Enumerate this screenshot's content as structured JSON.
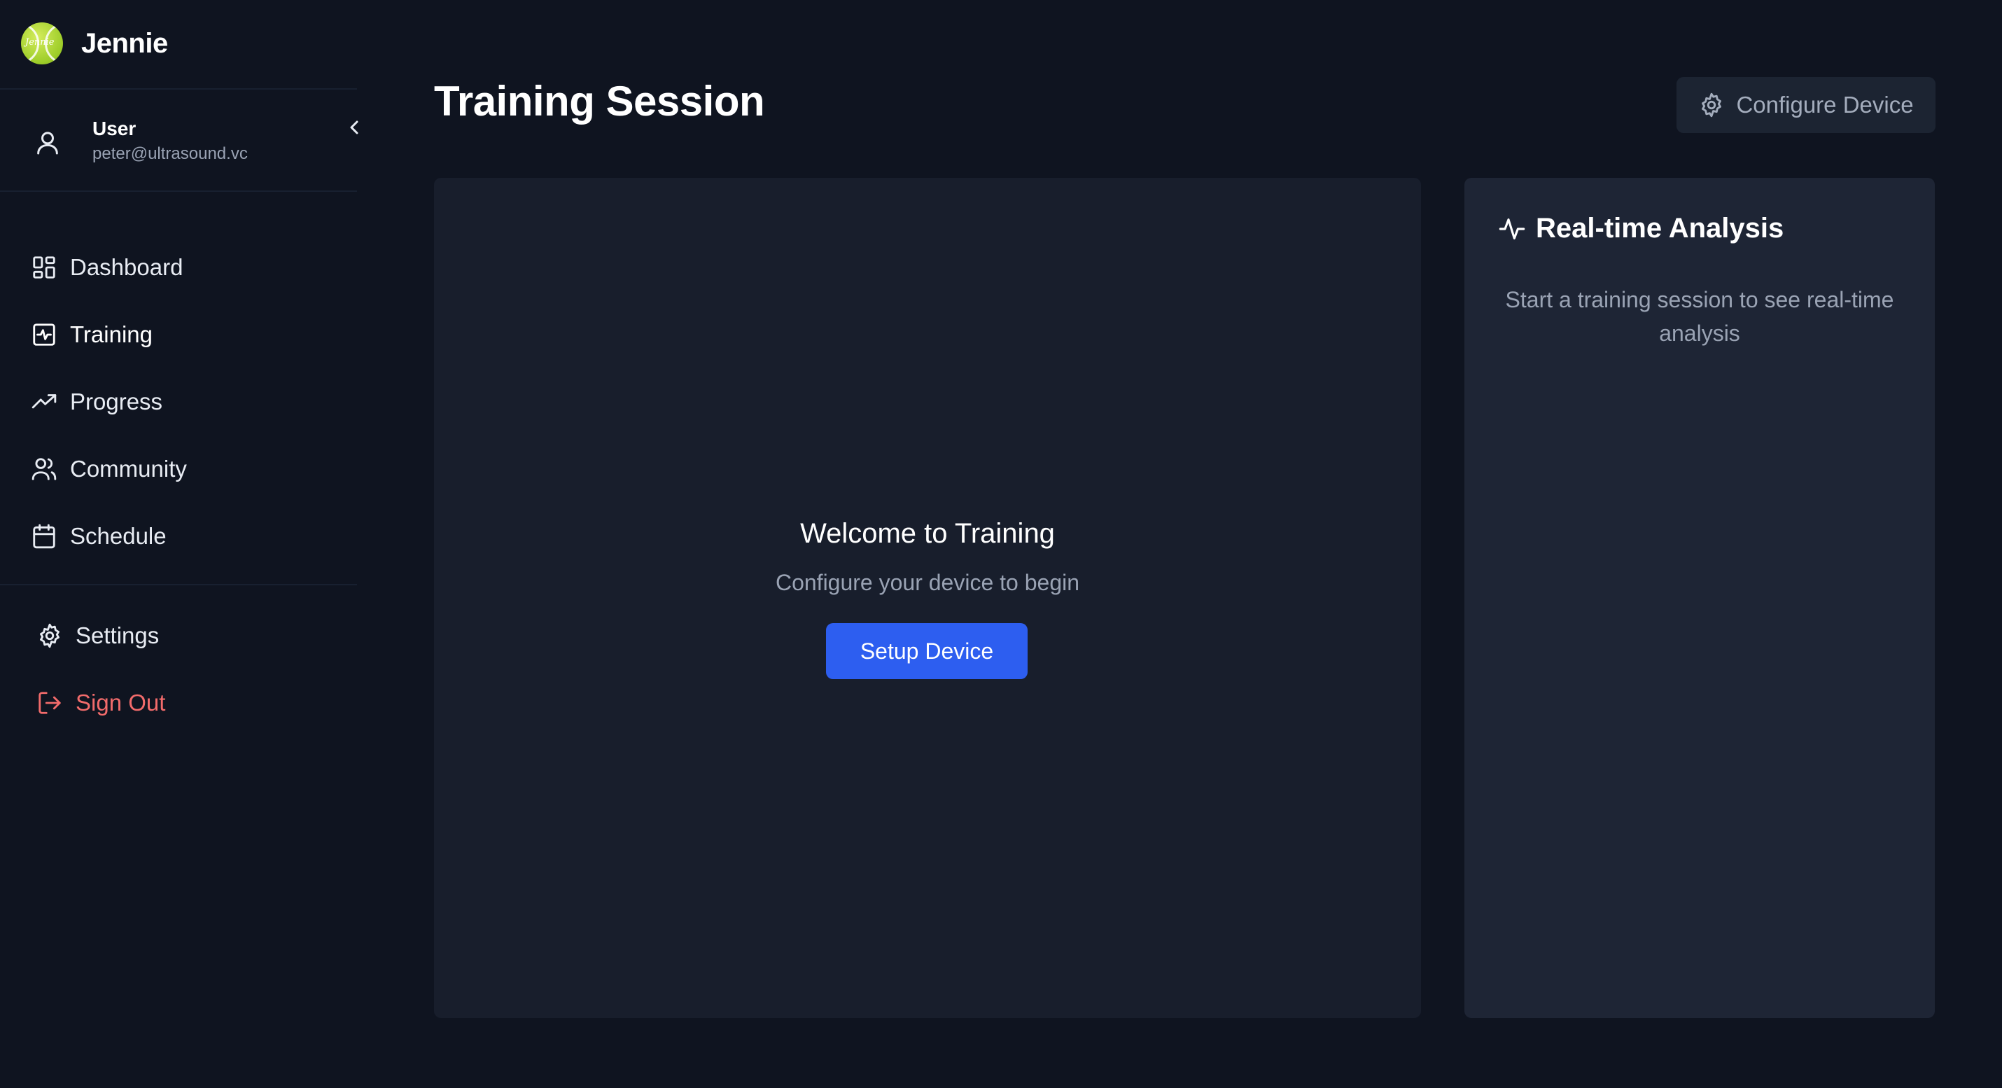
{
  "brand": {
    "name": "Jennie",
    "logo_text": "Jennie"
  },
  "user": {
    "name": "User",
    "email": "peter@ultrasound.vc"
  },
  "nav": {
    "items": [
      {
        "label": "Dashboard",
        "icon": "dashboard-icon"
      },
      {
        "label": "Training",
        "icon": "training-icon"
      },
      {
        "label": "Progress",
        "icon": "progress-icon"
      },
      {
        "label": "Community",
        "icon": "community-icon"
      },
      {
        "label": "Schedule",
        "icon": "calendar-icon"
      }
    ],
    "bottom": [
      {
        "label": "Settings",
        "icon": "gear-icon"
      },
      {
        "label": "Sign Out",
        "icon": "sign-out-icon"
      }
    ]
  },
  "header": {
    "title": "Training Session",
    "configure_label": "Configure Device"
  },
  "training": {
    "title": "Welcome to Training",
    "subtitle": "Configure your device to begin",
    "setup_label": "Setup Device"
  },
  "analysis": {
    "title": "Real-time Analysis",
    "text": "Start a training session to see real-time analysis"
  },
  "colors": {
    "background": "#0f1420",
    "panel": "#181e2c",
    "accent": "#2d5ef0",
    "sign_out": "#f26b6b"
  }
}
